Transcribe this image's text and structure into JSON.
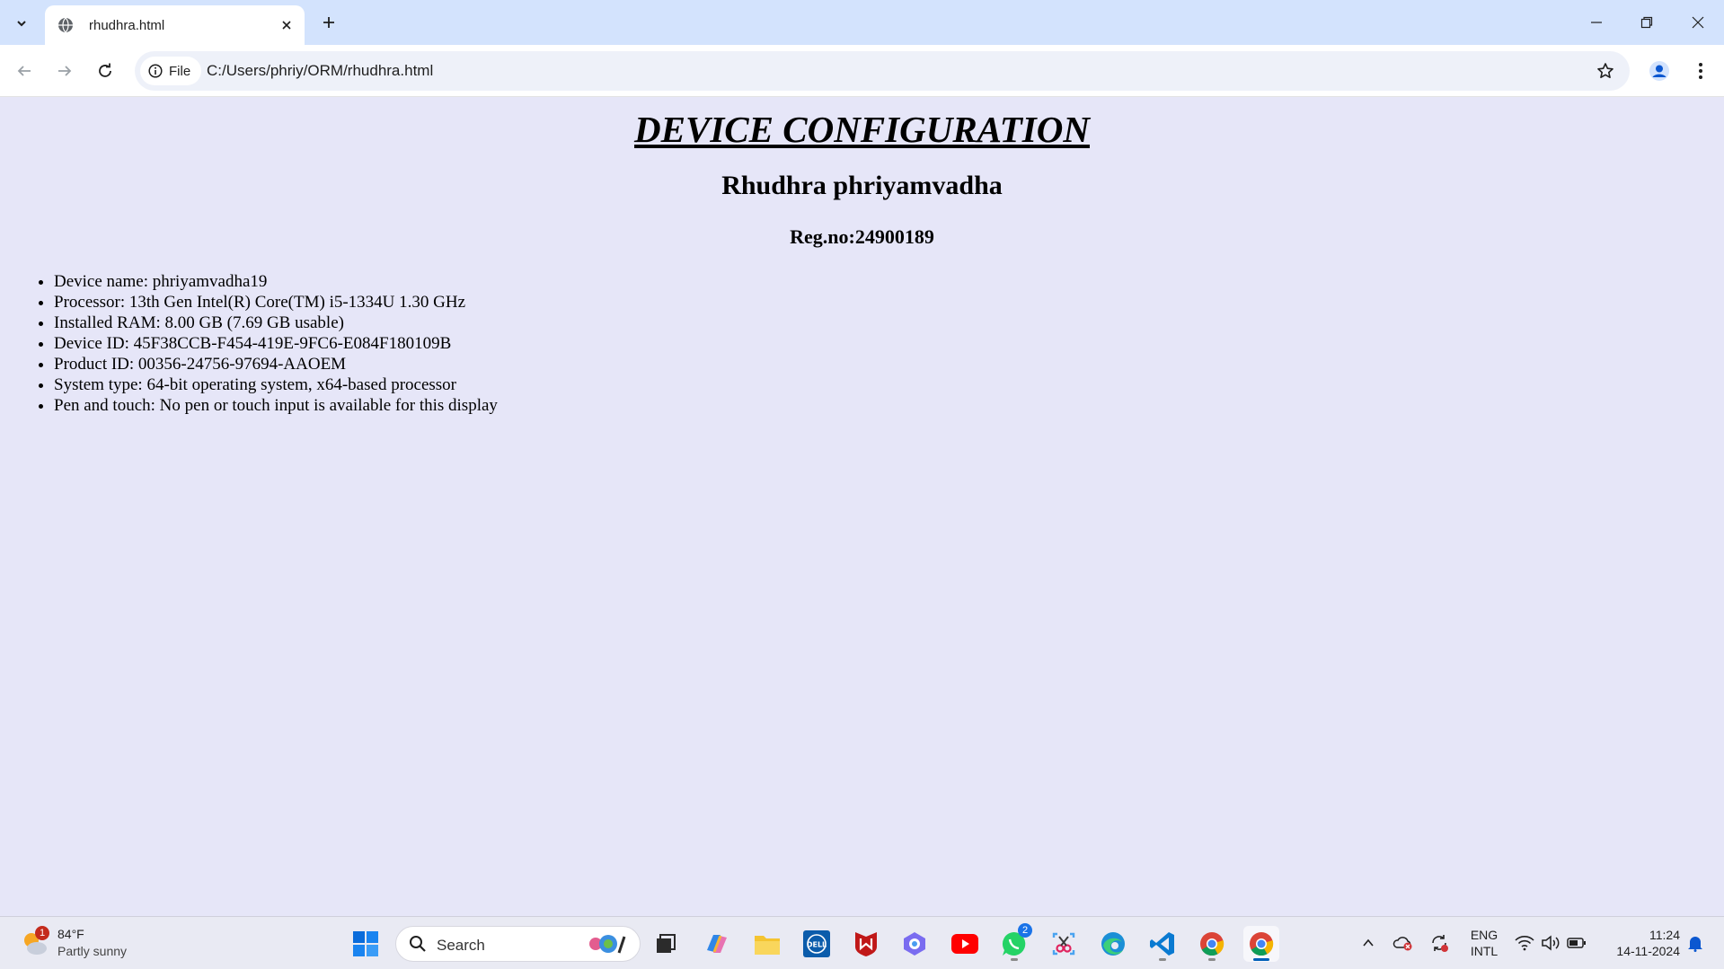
{
  "browser": {
    "tab_title": "rhudhra.html",
    "site_chip_label": "File",
    "url": "C:/Users/phriy/ORM/rhudhra.html"
  },
  "page": {
    "title": "DEVICE CONFIGURATION",
    "name": "Rhudhra phriyamvadha",
    "reg_no": "Reg.no:24900189",
    "specs": [
      "Device name: phriyamvadha19",
      "Processor: 13th Gen Intel(R) Core(TM) i5-1334U 1.30 GHz",
      "Installed RAM: 8.00 GB (7.69 GB usable)",
      "Device ID: 45F38CCB-F454-419E-9FC6-E084F180109B",
      "Product ID: 00356-24756-97694-AAOEM",
      "System type: 64-bit operating system, x64-based processor",
      "Pen and touch: No pen or touch input is available for this display"
    ]
  },
  "taskbar": {
    "weather": {
      "temp": "84°F",
      "desc": "Partly sunny",
      "badge": "1"
    },
    "search_placeholder": "Search",
    "whatsapp_badge": "2",
    "lang_line1": "ENG",
    "lang_line2": "INTL",
    "time": "11:24",
    "date": "14-11-2024",
    "apps": [
      "start-icon",
      "search-highlights-icon",
      "task-view-icon",
      "copilot-icon",
      "file-explorer-icon",
      "dell-icon",
      "mcafee-icon",
      "game-bar-icon",
      "youtube-icon",
      "whatsapp-icon",
      "snipping-tool-icon",
      "edge-icon",
      "vscode-icon",
      "chrome-icon",
      "chrome-active-icon"
    ]
  },
  "colors": {
    "page_bg": "#e6e6f8",
    "tabstrip_bg": "#d3e3fd",
    "taskbar_bg": "#e9eaf3"
  }
}
